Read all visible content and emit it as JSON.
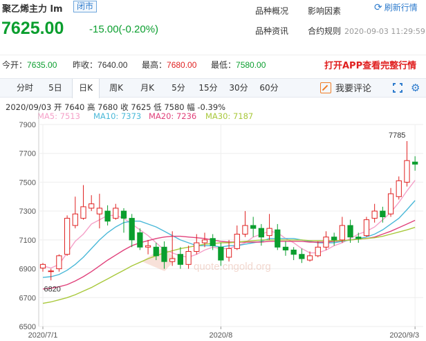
{
  "quote": {
    "name": "聚乙烯主力 lm",
    "market_badge": "闭市",
    "price": "7625.00",
    "change": "-15.00(-0.20%)",
    "datetime": "2020-09-03 11:29:59"
  },
  "header_links": {
    "overview": "品种概况",
    "factors": "影响因素",
    "news": "品种资讯",
    "rules": "合约规则",
    "refresh": "刷新行情"
  },
  "stats": {
    "open_label": "今开：",
    "open": "7635.00",
    "prev_close_label": "昨收：",
    "prev_close": "7640.00",
    "high_label": "最高：",
    "high": "7680.00",
    "low_label": "最低：",
    "low": "7580.00",
    "app_link": "打开APP查看完整行情"
  },
  "tabs": [
    "分时",
    "5日",
    "日K",
    "周K",
    "月K",
    "5分",
    "15分",
    "30分",
    "60分"
  ],
  "active_tab": "日K",
  "comment_label": "我要评论",
  "icons": {
    "refresh": "refresh-icon",
    "comment": "edit-icon",
    "expand": "expand-icon",
    "settings": "settings-icon"
  },
  "info_line": "2020/09/03  开 7640  高 7680  收 7625  低 7580  幅 -0.39%",
  "ma_legend": [
    {
      "label": "MA5: 7513",
      "color": "#f5a0c8"
    },
    {
      "label": "MA10: 7373",
      "color": "#49b8d8"
    },
    {
      "label": "MA20: 7236",
      "color": "#e0407a"
    },
    {
      "label": "MA30: 7187",
      "color": "#a8c83a"
    }
  ],
  "watermark": "quote.cngold.org",
  "colors": {
    "up": "#e02020",
    "down": "#0a9e2e",
    "accent": "#2f7ccd"
  },
  "chart_data": {
    "type": "candlestick",
    "y_ticks": [
      7900,
      7700,
      7500,
      7300,
      7100,
      6900,
      6700,
      6500
    ],
    "ylim": [
      6500,
      7900
    ],
    "x_labels": [
      {
        "label": "2020/7/1",
        "index": 0
      },
      {
        "label": "2020/8",
        "index": 22
      },
      {
        "label": "2020/9/3",
        "index": 46
      }
    ],
    "annotations": [
      {
        "text": "7785",
        "index": 45,
        "value": 7785
      },
      {
        "text": "6820",
        "index": 1,
        "value": 6820
      }
    ],
    "candles": [
      [
        6905,
        6930,
        6880,
        6940
      ],
      [
        6880,
        6885,
        6820,
        6900
      ],
      [
        6900,
        6990,
        6880,
        7000
      ],
      [
        7000,
        7250,
        6990,
        7270
      ],
      [
        7200,
        7280,
        7180,
        7400
      ],
      [
        7250,
        7330,
        7240,
        7480
      ],
      [
        7320,
        7350,
        7300,
        7410
      ],
      [
        7280,
        7320,
        7180,
        7420
      ],
      [
        7300,
        7230,
        7200,
        7340
      ],
      [
        7250,
        7320,
        7240,
        7350
      ],
      [
        7300,
        7250,
        7150,
        7320
      ],
      [
        7250,
        7100,
        7050,
        7280
      ],
      [
        7150,
        7050,
        7030,
        7180
      ],
      [
        7050,
        7060,
        7000,
        7100
      ],
      [
        7050,
        6990,
        6960,
        7080
      ],
      [
        7050,
        6950,
        6900,
        7090
      ],
      [
        6950,
        6970,
        6920,
        7160
      ],
      [
        7000,
        6930,
        6900,
        7050
      ],
      [
        6930,
        7020,
        6900,
        7060
      ],
      [
        7020,
        7080,
        7000,
        7140
      ],
      [
        7080,
        7100,
        7050,
        7150
      ],
      [
        7110,
        7060,
        7030,
        7140
      ],
      [
        7050,
        6960,
        6920,
        7080
      ],
      [
        6980,
        7040,
        6950,
        7100
      ],
      [
        7040,
        7140,
        7030,
        7200
      ],
      [
        7140,
        7200,
        7120,
        7300
      ],
      [
        7200,
        7180,
        7120,
        7260
      ],
      [
        7180,
        7120,
        7060,
        7210
      ],
      [
        7130,
        7180,
        7100,
        7280
      ],
      [
        7170,
        7050,
        7030,
        7210
      ],
      [
        7050,
        7030,
        6990,
        7090
      ],
      [
        7030,
        7000,
        6960,
        7050
      ],
      [
        7000,
        6970,
        6940,
        7040
      ],
      [
        6960,
        6990,
        6950,
        7020
      ],
      [
        6990,
        7050,
        6980,
        7090
      ],
      [
        7050,
        7120,
        7030,
        7160
      ],
      [
        7120,
        7100,
        7060,
        7150
      ],
      [
        7100,
        7200,
        7080,
        7260
      ],
      [
        7200,
        7120,
        7080,
        7240
      ],
      [
        7120,
        7110,
        7080,
        7150
      ],
      [
        7130,
        7240,
        7120,
        7260
      ],
      [
        7250,
        7300,
        7220,
        7350
      ],
      [
        7300,
        7260,
        7220,
        7330
      ],
      [
        7280,
        7420,
        7260,
        7460
      ],
      [
        7400,
        7510,
        7380,
        7540
      ],
      [
        7500,
        7650,
        7470,
        7785
      ],
      [
        7640,
        7625,
        7580,
        7680
      ]
    ],
    "ma": {
      "MA5": [
        6920,
        6905,
        6930,
        7010,
        7090,
        7140,
        7210,
        7240,
        7270,
        7270,
        7250,
        7210,
        7170,
        7130,
        7080,
        7030,
        7010,
        6990,
        6980,
        7000,
        7030,
        7050,
        7040,
        7040,
        7060,
        7080,
        7120,
        7140,
        7160,
        7150,
        7110,
        7080,
        7040,
        7010,
        7010,
        7030,
        7060,
        7080,
        7110,
        7140,
        7160,
        7190,
        7240,
        7290,
        7360,
        7440,
        7513
      ],
      "MA10": [
        6840,
        6845,
        6860,
        6890,
        6930,
        6980,
        7040,
        7100,
        7150,
        7190,
        7220,
        7230,
        7230,
        7210,
        7190,
        7160,
        7130,
        7100,
        7080,
        7060,
        7060,
        7060,
        7050,
        7060,
        7060,
        7070,
        7080,
        7090,
        7110,
        7110,
        7110,
        7110,
        7100,
        7090,
        7080,
        7080,
        7080,
        7090,
        7100,
        7110,
        7120,
        7140,
        7170,
        7210,
        7250,
        7310,
        7373
      ],
      "MA20": [
        6760,
        6765,
        6775,
        6790,
        6815,
        6845,
        6880,
        6920,
        6960,
        6995,
        7030,
        7060,
        7080,
        7095,
        7110,
        7120,
        7125,
        7125,
        7120,
        7115,
        7110,
        7100,
        7090,
        7085,
        7085,
        7085,
        7085,
        7085,
        7090,
        7090,
        7090,
        7090,
        7090,
        7085,
        7085,
        7085,
        7090,
        7095,
        7100,
        7105,
        7110,
        7120,
        7140,
        7160,
        7185,
        7210,
        7236
      ],
      "MA30": [
        6660,
        6670,
        6685,
        6700,
        6720,
        6745,
        6770,
        6800,
        6830,
        6860,
        6890,
        6920,
        6945,
        6970,
        6990,
        7010,
        7025,
        7040,
        7050,
        7060,
        7070,
        7075,
        7080,
        7080,
        7085,
        7090,
        7095,
        7100,
        7100,
        7100,
        7100,
        7100,
        7100,
        7095,
        7095,
        7095,
        7095,
        7095,
        7100,
        7105,
        7110,
        7115,
        7125,
        7140,
        7155,
        7170,
        7187
      ]
    }
  }
}
